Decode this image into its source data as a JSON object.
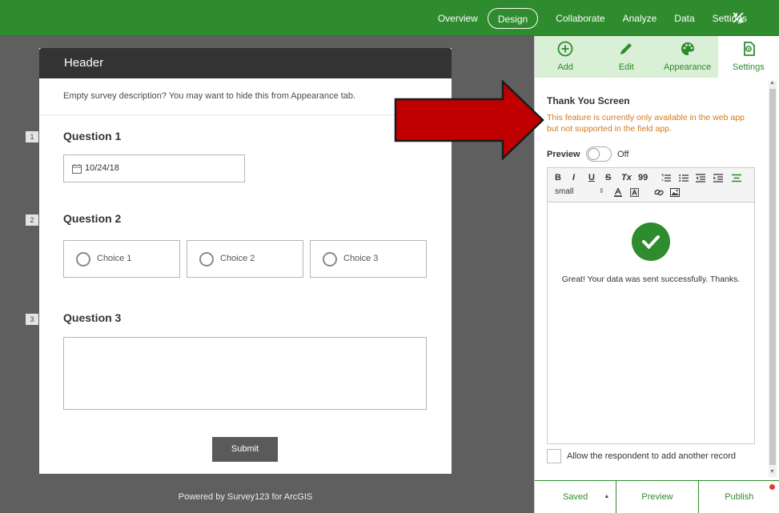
{
  "nav": {
    "items": [
      "Overview",
      "Design",
      "Collaborate",
      "Analyze",
      "Data",
      "Settings"
    ],
    "active": "Design"
  },
  "survey": {
    "header": "Header",
    "description": "Empty survey description? You may want to hide this from Appearance tab.",
    "questions": [
      {
        "num": "1",
        "title": "Question 1",
        "value": "10/24/18"
      },
      {
        "num": "2",
        "title": "Question 2",
        "choices": [
          "Choice 1",
          "Choice 2",
          "Choice 3"
        ]
      },
      {
        "num": "3",
        "title": "Question 3"
      }
    ],
    "submit": "Submit",
    "powered": "Powered by Survey123 for ArcGIS"
  },
  "panel": {
    "tabs": [
      "Add",
      "Edit",
      "Appearance",
      "Settings"
    ],
    "active_tab": "Settings",
    "thank_you_title": "Thank You Screen",
    "warning": "This feature is currently only available in the web app but not supported in the field app.",
    "preview_label": "Preview",
    "preview_state": "Off",
    "toolbar": {
      "bold": "B",
      "italic": "I",
      "underline": "U",
      "strike": "S",
      "clear": "Tx",
      "quote": "99",
      "size": "small"
    },
    "success_message": "Great! Your data was sent successfully. Thanks.",
    "allow_label": "Allow the respondent to add another record",
    "bottom": {
      "saved": "Saved",
      "preview": "Preview",
      "publish": "Publish"
    }
  },
  "colors": {
    "brand": "#2e8b2e",
    "warning": "#d07a1f",
    "arrow": "#c00000"
  }
}
